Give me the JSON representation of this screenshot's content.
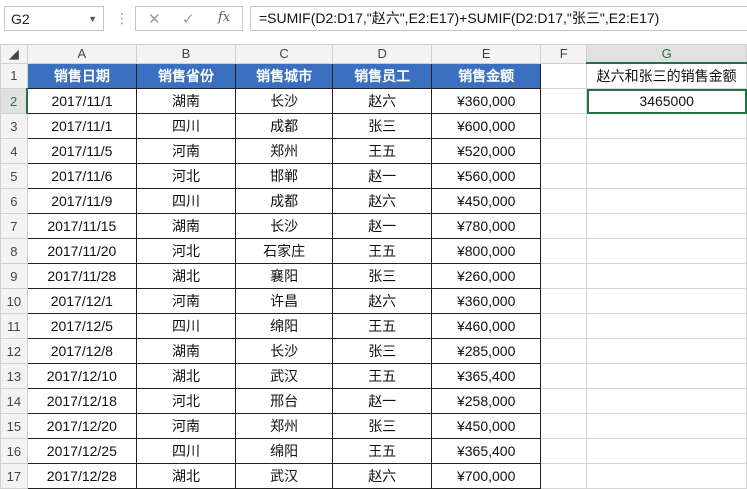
{
  "name_box": "G2",
  "formula": "=SUMIF(D2:D17,\"赵六\",E2:E17)+SUMIF(D2:D17,\"张三\",E2:E17)",
  "columns": [
    "A",
    "B",
    "C",
    "D",
    "E",
    "F",
    "G"
  ],
  "headers": [
    "销售日期",
    "销售省份",
    "销售城市",
    "销售员工",
    "销售金额"
  ],
  "g1": "赵六和张三的销售金额",
  "g2": "3465000",
  "rows": [
    [
      "2017/11/1",
      "湖南",
      "长沙",
      "赵六",
      "¥360,000"
    ],
    [
      "2017/11/1",
      "四川",
      "成都",
      "张三",
      "¥600,000"
    ],
    [
      "2017/11/5",
      "河南",
      "郑州",
      "王五",
      "¥520,000"
    ],
    [
      "2017/11/6",
      "河北",
      "邯郸",
      "赵一",
      "¥560,000"
    ],
    [
      "2017/11/9",
      "四川",
      "成都",
      "赵六",
      "¥450,000"
    ],
    [
      "2017/11/15",
      "湖南",
      "长沙",
      "赵一",
      "¥780,000"
    ],
    [
      "2017/11/20",
      "河北",
      "石家庄",
      "王五",
      "¥800,000"
    ],
    [
      "2017/11/28",
      "湖北",
      "襄阳",
      "张三",
      "¥260,000"
    ],
    [
      "2017/12/1",
      "河南",
      "许昌",
      "赵六",
      "¥360,000"
    ],
    [
      "2017/12/5",
      "四川",
      "绵阳",
      "王五",
      "¥460,000"
    ],
    [
      "2017/12/8",
      "湖南",
      "长沙",
      "张三",
      "¥285,000"
    ],
    [
      "2017/12/10",
      "湖北",
      "武汉",
      "王五",
      "¥365,400"
    ],
    [
      "2017/12/18",
      "河北",
      "邢台",
      "赵一",
      "¥258,000"
    ],
    [
      "2017/12/20",
      "河南",
      "郑州",
      "张三",
      "¥450,000"
    ],
    [
      "2017/12/25",
      "四川",
      "绵阳",
      "王五",
      "¥365,400"
    ],
    [
      "2017/12/28",
      "湖北",
      "武汉",
      "赵六",
      "¥700,000"
    ]
  ]
}
